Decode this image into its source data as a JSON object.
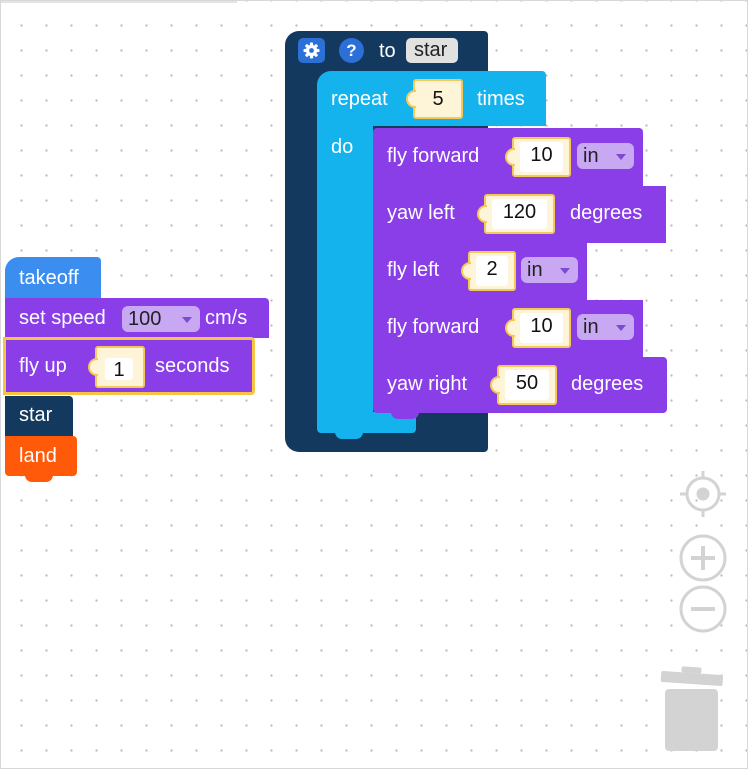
{
  "left_stack": {
    "takeoff": "takeoff",
    "set_speed": {
      "label": "set speed",
      "value": "100",
      "unit": "cm/s"
    },
    "fly_up": {
      "label": "fly up",
      "value": "1",
      "unit": "seconds"
    },
    "star_call": "star",
    "land": "land"
  },
  "function_block": {
    "to_label": "to",
    "name": "star",
    "repeat": {
      "label": "repeat",
      "count": "5",
      "times_label": "times",
      "do_label": "do"
    },
    "body": [
      {
        "label": "fly forward",
        "value": "10",
        "unit": "in"
      },
      {
        "label": "yaw left",
        "value": "120",
        "unit": "degrees"
      },
      {
        "label": "fly left",
        "value": "2",
        "unit": "in"
      },
      {
        "label": "fly forward",
        "value": "10",
        "unit": "in"
      },
      {
        "label": "yaw right",
        "value": "50",
        "unit": "degrees"
      }
    ]
  },
  "colors": {
    "motion": "#8a3ee8",
    "function": "#133a5e",
    "loop": "#14b3ee",
    "takeoff": "#3b8ef0",
    "land": "#ff5a0a",
    "value_fill": "#fef4d8",
    "value_border": "#f6c858",
    "controls": "#d3d3d3"
  },
  "controls": [
    "center-icon",
    "zoom-in-icon",
    "zoom-out-icon",
    "trash-icon"
  ]
}
